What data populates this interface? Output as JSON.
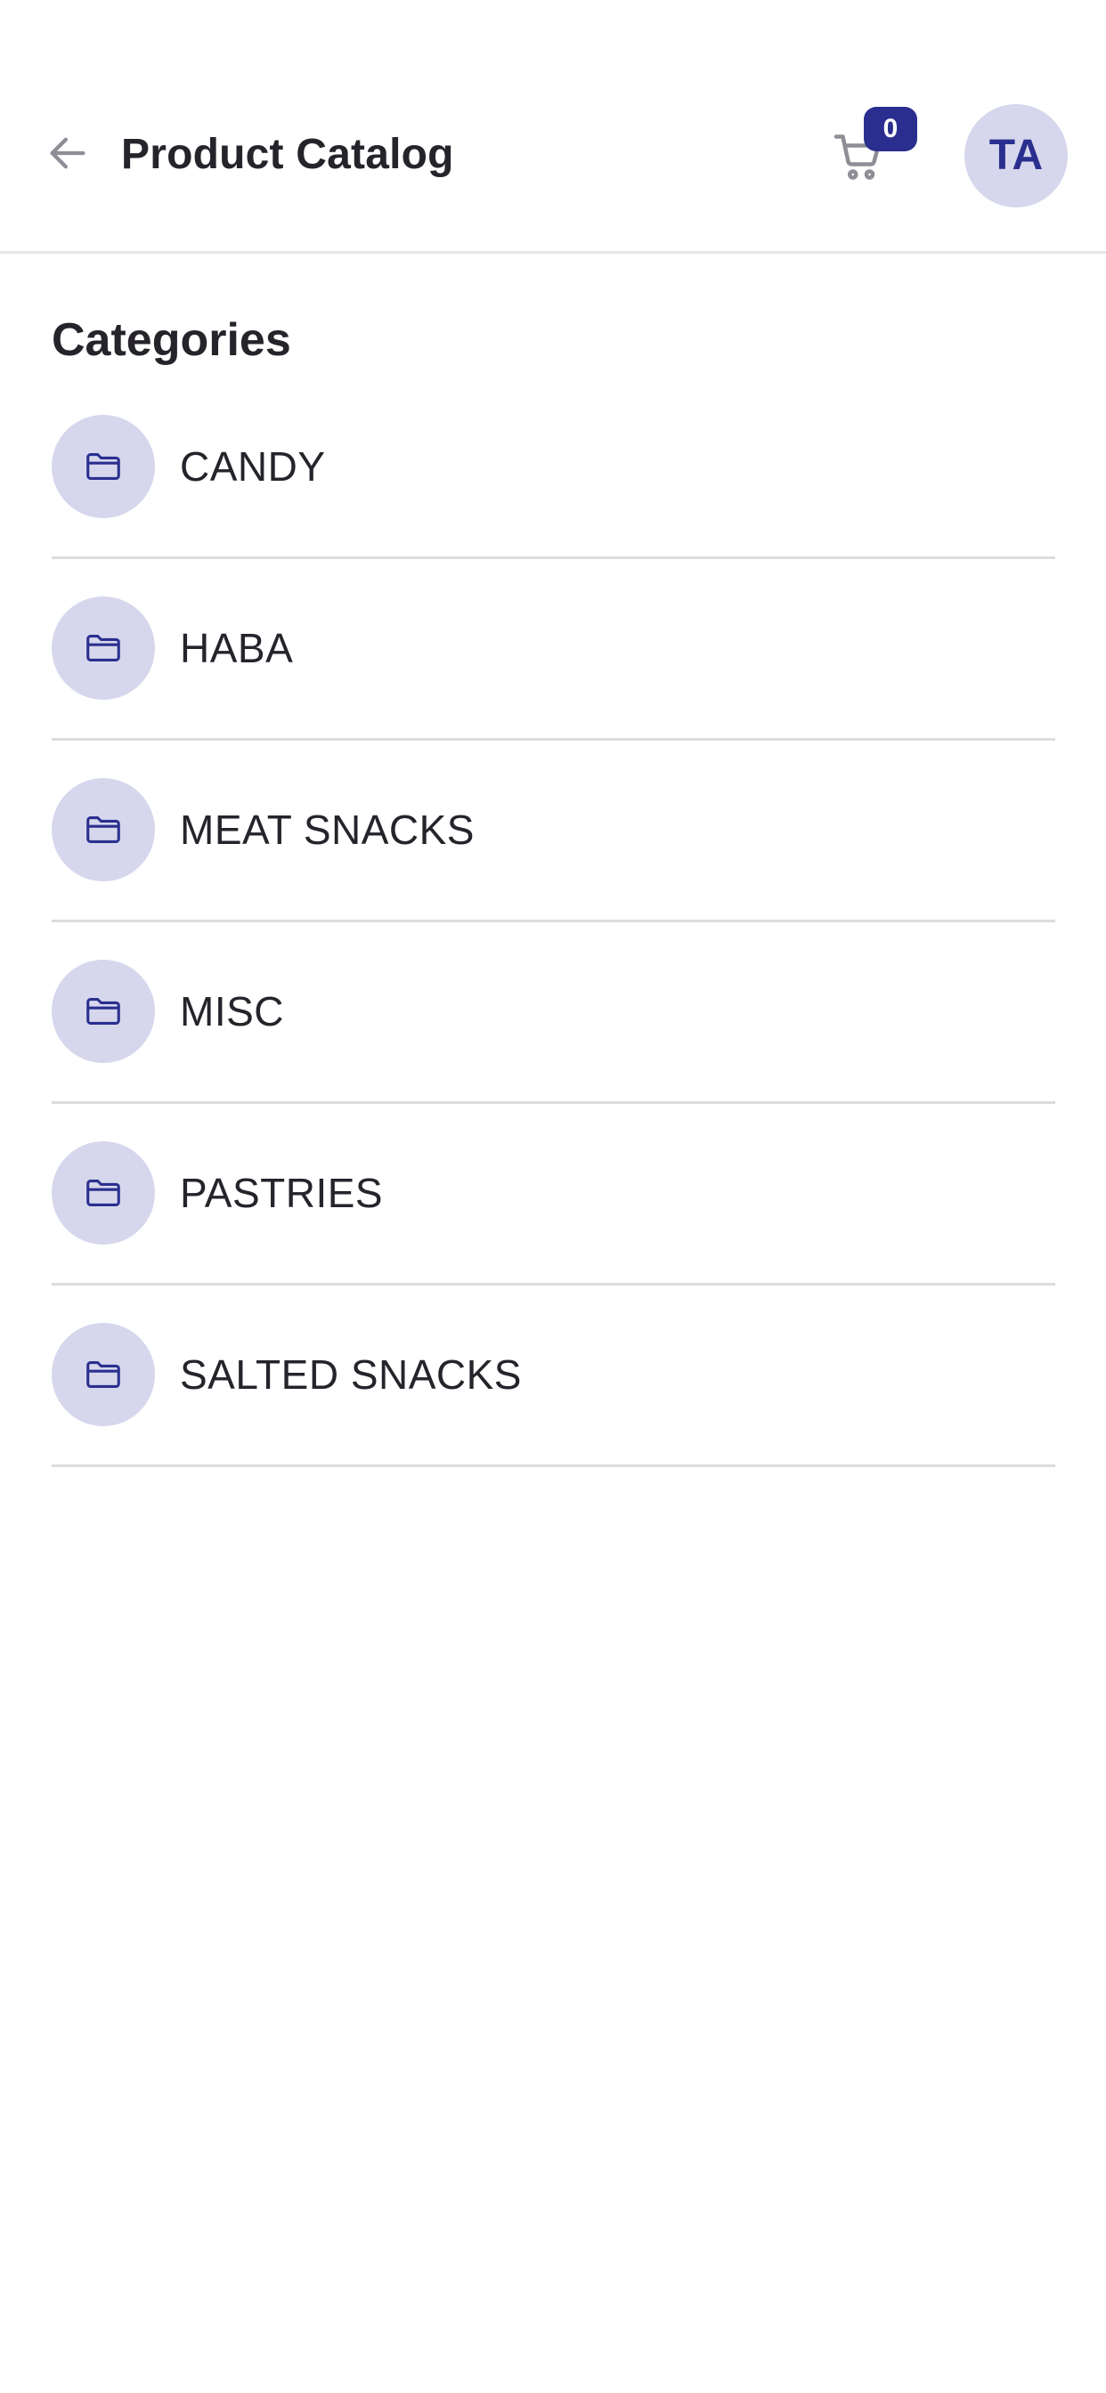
{
  "header": {
    "title": "Product Catalog",
    "back_icon": "arrow-left-icon",
    "cart_icon": "shopping-cart-icon",
    "cart_count": "0",
    "avatar_initials": "TA"
  },
  "section": {
    "title": "Categories"
  },
  "categories": [
    {
      "label": "CANDY",
      "icon": "folder-icon"
    },
    {
      "label": "HABA",
      "icon": "folder-icon"
    },
    {
      "label": "MEAT SNACKS",
      "icon": "folder-icon"
    },
    {
      "label": "MISC",
      "icon": "folder-icon"
    },
    {
      "label": "PASTRIES",
      "icon": "folder-icon"
    },
    {
      "label": "SALTED SNACKS",
      "icon": "folder-icon"
    }
  ],
  "colors": {
    "accent": "#2a2f8f",
    "accent_soft": "#d6d7ec",
    "text": "#26232b",
    "divider": "#dcdce0",
    "icon_gray": "#8f8d96"
  }
}
